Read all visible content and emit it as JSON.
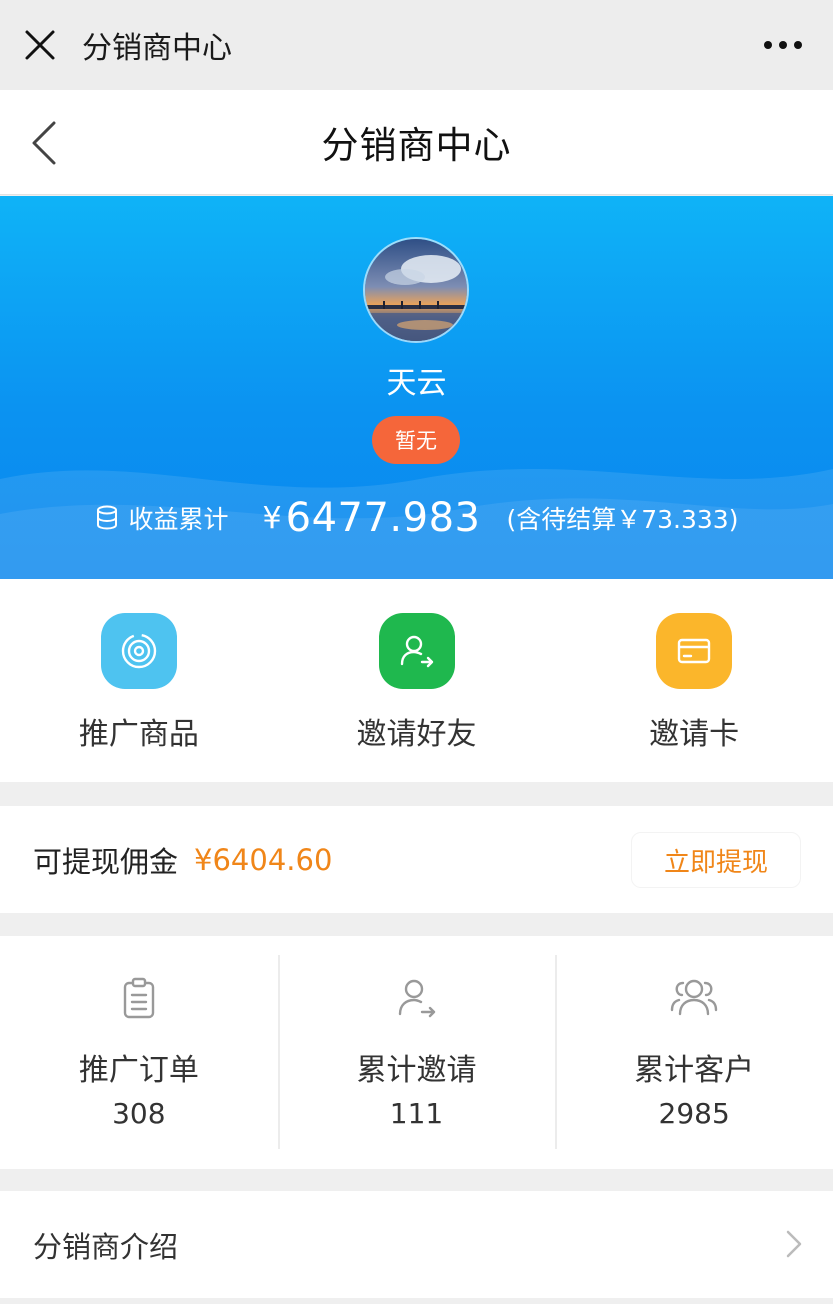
{
  "wechat_bar": {
    "title": "分销商中心"
  },
  "header": {
    "title": "分销商中心"
  },
  "profile": {
    "name": "天云",
    "level_badge": "暂无",
    "earnings_label": "收益累计",
    "earnings_currency": "¥",
    "earnings_total": "6477.983",
    "earnings_pending": "(含待结算￥73.333)"
  },
  "actions": [
    {
      "label": "推广商品",
      "icon": "target-icon",
      "color": "#4ec3f0"
    },
    {
      "label": "邀请好友",
      "icon": "invite-friend-icon",
      "color": "#1fb84e"
    },
    {
      "label": "邀请卡",
      "icon": "card-icon",
      "color": "#fbb62b"
    }
  ],
  "commission": {
    "label": "可提现佣金",
    "amount": "¥6404.60",
    "withdraw_label": "立即提现"
  },
  "stats": [
    {
      "label": "推广订单",
      "value": "308",
      "icon": "clipboard-icon"
    },
    {
      "label": "累计邀请",
      "value": "111",
      "icon": "user-arrow-icon"
    },
    {
      "label": "累计客户",
      "value": "2985",
      "icon": "users-icon"
    }
  ],
  "intro": {
    "label": "分销商介绍"
  },
  "colors": {
    "hero_top": "#0fb3f7",
    "hero_bottom": "#0a86ee",
    "badge": "#f5663a",
    "accent_orange": "#f08619"
  }
}
